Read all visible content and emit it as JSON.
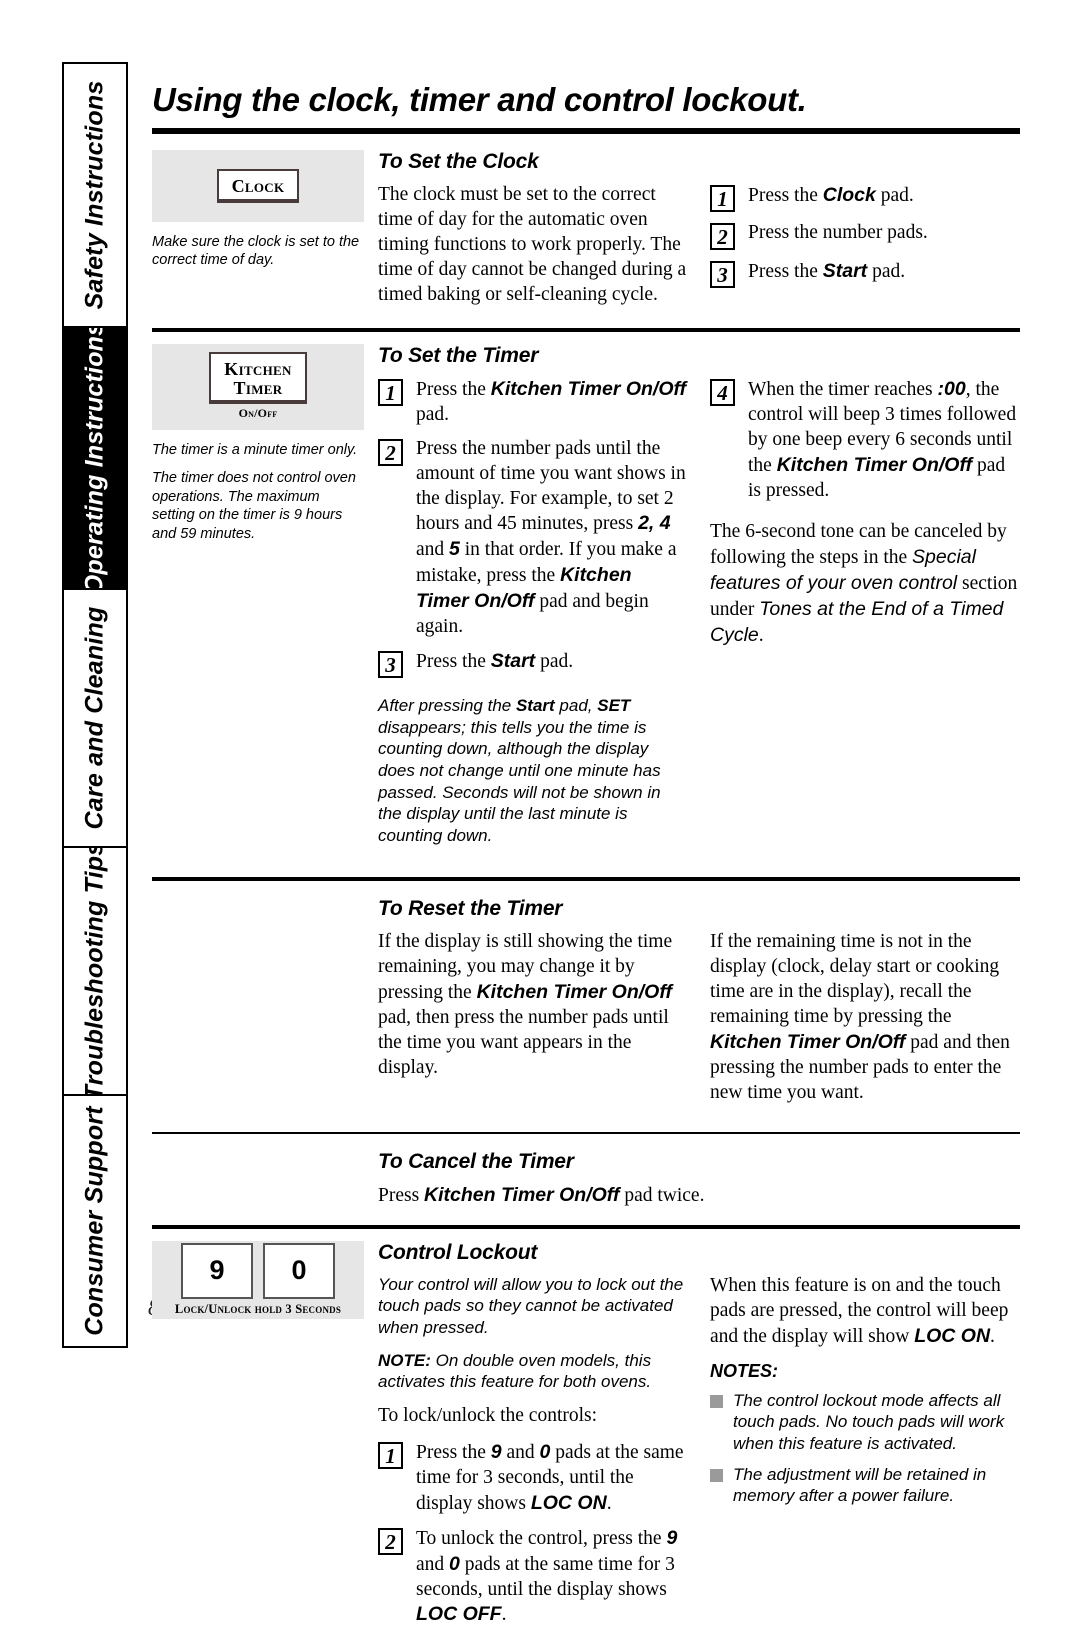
{
  "page": {
    "number": "8",
    "title": "Using the clock, timer and control lockout."
  },
  "sidebar": {
    "tabs": [
      {
        "label": "Safety Instructions",
        "active": false
      },
      {
        "label": "Operating Instructions",
        "active": true
      },
      {
        "label": "Care and Cleaning",
        "active": false
      },
      {
        "label": "Troubleshooting Tips",
        "active": false
      },
      {
        "label": "Consumer Support",
        "active": false
      }
    ]
  },
  "sections": {
    "set_clock": {
      "heading": "To Set the Clock",
      "pad_label": "Clock",
      "aside_note": "Make sure the clock is set to the correct time of day.",
      "body": "The clock must be set to the correct time of day for the automatic oven timing functions to work properly. The time of day cannot be changed during a timed baking or self-cleaning cycle.",
      "steps": [
        {
          "num": "1",
          "pre": "Press the ",
          "bold": "Clock",
          "post": " pad."
        },
        {
          "num": "2",
          "pre": "Press the number  pads.",
          "bold": "",
          "post": ""
        },
        {
          "num": "3",
          "pre": "Press the ",
          "bold": "Start",
          "post": " pad."
        }
      ]
    },
    "set_timer": {
      "heading": "To Set the Timer",
      "pad_label_line1": "Kitchen",
      "pad_label_line2": "Timer",
      "pad_sublabel": "On/Off",
      "aside_note_1": "The timer is a minute timer only.",
      "aside_note_2": "The timer does not control oven operations. The maximum setting on the timer is 9 hours and 59 minutes.",
      "step1_num": "1",
      "step1_a": "Press the ",
      "step1_b": "Kitchen Timer On/Off",
      "step1_c": " pad.",
      "step2_num": "2",
      "step2_a": "Press the number pads until the amount of time you want shows in the display. For example, to set 2 hours and 45 minutes, press ",
      "step2_b": "2, 4",
      "step2_c": " and ",
      "step2_d": "5",
      "step2_e": " in that order. If you make a mistake, press the ",
      "step2_f": "Kitchen Timer On/Off",
      "step2_g": " pad and begin again.",
      "step3_num": "3",
      "step3_a": "Press the ",
      "step3_b": "Start",
      "step3_c": " pad.",
      "after_note_a": "After pressing the ",
      "after_note_b": "Start",
      "after_note_c": " pad, ",
      "after_note_d": "SET",
      "after_note_e": " disappears; this tells you the time is counting down, although the display does not change until one minute has passed. Seconds will not be shown in the display until the last minute is counting down.",
      "step4_num": "4",
      "step4_a": "When the timer reaches ",
      "step4_b": ":00",
      "step4_c": ", the control will beep 3 times followed by one beep every 6 seconds until the ",
      "step4_d": "Kitchen Timer On/Off",
      "step4_e": " pad is pressed.",
      "tone_a": "The 6-second tone can be canceled by following the steps in the ",
      "tone_b": "Special features of your oven control",
      "tone_c": " section under ",
      "tone_d": "Tones at the End of a Timed Cycle",
      "tone_e": "."
    },
    "reset_timer": {
      "heading": "To Reset the Timer",
      "left_a": "If the display is still showing the time remaining, you may change it by pressing the ",
      "left_b": "Kitchen Timer On/Off",
      "left_c": " pad, then press the number pads until the time you want appears in the display.",
      "right_a": "If the remaining time is not in the display (clock, delay start or cooking time are in the display), recall the remaining time by pressing the ",
      "right_b": "Kitchen Timer On/Off",
      "right_c": " pad and then pressing the number pads to enter the new time you want."
    },
    "cancel_timer": {
      "heading": "To Cancel the Timer",
      "body_a": "Press ",
      "body_b": "Kitchen Timer On/Off",
      "body_c": " pad twice."
    },
    "control_lockout": {
      "heading": "Control Lockout",
      "pad_9": "9",
      "pad_0": "0",
      "pad_caption": "Lock/Unlock hold 3 Seconds",
      "intro": "Your control will allow you to lock out the touch pads so they cannot be activated when pressed.",
      "note_label": "NOTE:",
      "note_body": " On double oven models, this activates this feature for both ovens.",
      "lead_in": "To lock/unlock the controls:",
      "step1_num": "1",
      "step1_a": "Press the ",
      "step1_b": "9",
      "step1_c": " and ",
      "step1_d": "0",
      "step1_e": " pads at the same time for 3 seconds, until the display shows ",
      "step1_f": "LOC ON",
      "step1_g": ".",
      "step2_num": "2",
      "step2_a": "To unlock the control, press the ",
      "step2_b": "9",
      "step2_c": " and ",
      "step2_d": "0",
      "step2_e": " pads at the same time for 3 seconds, until the display shows ",
      "step2_f": "LOC OFF",
      "step2_g": ".",
      "right_a": "When this feature is on and the touch pads are pressed, the control will beep and the display will show ",
      "right_b": "LOC ON",
      "right_c": ".",
      "notes_head": "NOTES:",
      "notes": [
        "The control lockout mode affects all touch pads. No touch pads will work when this feature is activated.",
        "The adjustment will be retained in memory after a power failure."
      ]
    }
  }
}
